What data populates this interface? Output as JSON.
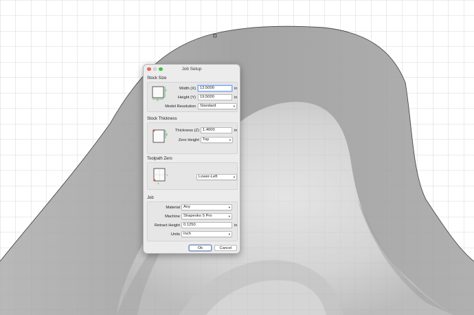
{
  "dialog": {
    "title": "Job Setup",
    "stock_size": {
      "title": "Stock Size",
      "width_label": "Width (X)",
      "width_value": "13.5000",
      "width_unit": "in",
      "height_label": "Height (Y)",
      "height_value": "19.5000",
      "height_unit": "in",
      "resolution_label": "Model Resolution",
      "resolution_value": "Standard"
    },
    "stock_thickness": {
      "title": "Stock Thickness",
      "thickness_label": "Thickness (Z)",
      "thickness_value": "1.4000",
      "thickness_unit": "in",
      "zero_height_label": "Zero Height",
      "zero_height_value": "Top"
    },
    "toolpath_zero": {
      "title": "Toolpath Zero",
      "position_value": "Lower-Left"
    },
    "job": {
      "title": "Job",
      "material_label": "Material",
      "material_value": "Any",
      "machine_label": "Machine",
      "machine_value": "Shapeoko 5 Pro",
      "retract_label": "Retract Height",
      "retract_value": "0.1250",
      "retract_unit": "in",
      "units_label": "Units",
      "units_value": "Inch"
    },
    "ok_label": "Ok",
    "cancel_label": "Cancel"
  },
  "axis_labels": {
    "x": "X",
    "y": "Y",
    "z": "Z"
  },
  "colors": {
    "accent": "#7aaaf5",
    "x_axis": "#e04a3a",
    "y_axis": "#3aa84a",
    "close": "#ee5f57",
    "maximize": "#3ec143"
  }
}
